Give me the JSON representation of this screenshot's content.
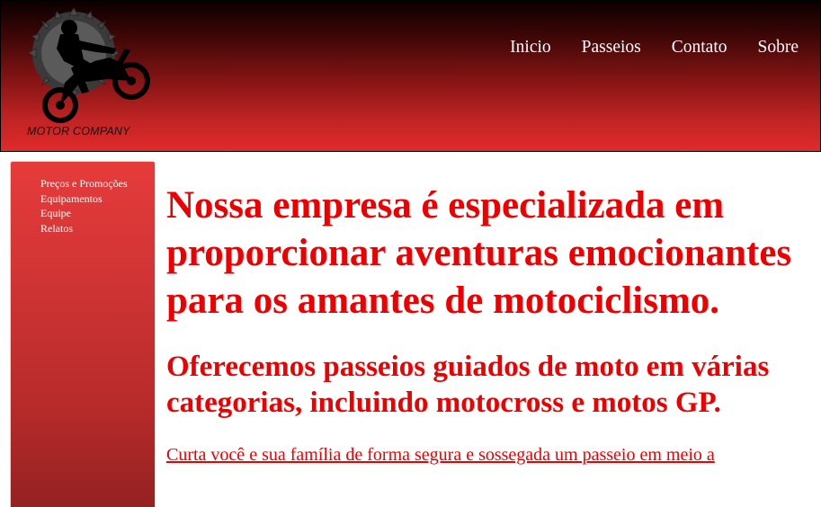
{
  "header": {
    "logo_text": "MOTOR COMPANY",
    "logo_icon": "motorcycle-rider-gear-logo",
    "nav": [
      "Inicio",
      "Passeios",
      "Contato",
      "Sobre"
    ]
  },
  "sidebar": {
    "items": [
      "Preços e Promoções",
      "Equipamentos",
      "Equipe",
      "Relatos"
    ]
  },
  "main": {
    "heading": "Nossa empresa é especializada em proporcionar aventuras emocionantes para os amantes de motociclismo.",
    "subheading": "Oferecemos passeios guiados de moto em várias categorias, incluindo motocross e motos GP.",
    "paragraph": "Curta você e sua família de forma segura e sossegada um passeio em meio a"
  },
  "colors": {
    "accent_red": "#ee0000",
    "header_dark": "#0a0000",
    "header_red": "#e02a2a",
    "sidebar_red": "#d33535"
  }
}
